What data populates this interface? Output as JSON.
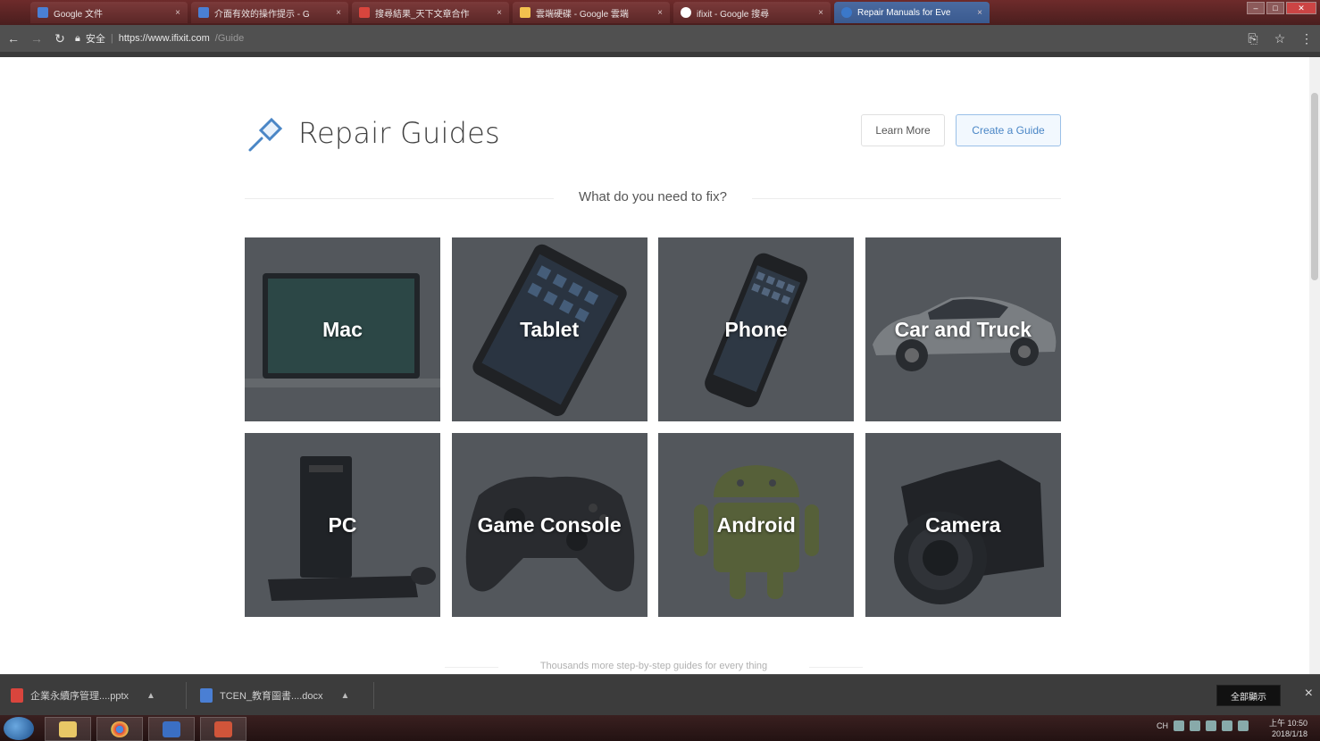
{
  "browser": {
    "tabs": [
      {
        "title": "Google 文件",
        "favicon_color": "#4a7fd4"
      },
      {
        "title": "介面有效的操作提示 - G",
        "favicon_color": "#4a7fd4"
      },
      {
        "title": "搜尋結果_天下文章合作",
        "favicon_color": "#d9453d"
      },
      {
        "title": "雲端硬碟 - Google 雲端",
        "favicon_color": "#f2c14e"
      },
      {
        "title": "ifixit - Google 搜尋",
        "favicon_color": "#ffffff"
      },
      {
        "title": "Repair Manuals for Eve",
        "favicon_color": "#3b78c9"
      }
    ],
    "tab_close": "×",
    "address": {
      "secure_label": "安全",
      "url_host": "https://www.ifixit.com",
      "url_path": "/Guide"
    }
  },
  "page": {
    "title": "Repair Guides",
    "learn_more": "Learn More",
    "create_guide": "Create a Guide",
    "prompt": "What do you need to fix?",
    "categories": [
      {
        "label": "Mac"
      },
      {
        "label": "Tablet"
      },
      {
        "label": "Phone"
      },
      {
        "label": "Car and Truck"
      },
      {
        "label": "PC"
      },
      {
        "label": "Game Console"
      },
      {
        "label": "Android"
      },
      {
        "label": "Camera"
      }
    ],
    "more_text": "Thousands more step-by-step guides for every thing"
  },
  "downloads": {
    "items": [
      {
        "name": "企業永續序管理....pptx",
        "color": "#d9453d"
      },
      {
        "name": "TCEN_教育圖書....docx",
        "color": "#4a7fd4"
      }
    ],
    "show_all": "全部顯示",
    "close": "×"
  },
  "taskbar": {
    "tray_lang": "CH",
    "time": "上午 10:50",
    "date": "2018/1/18"
  },
  "colors": {
    "brand_blue": "#4a86c6",
    "tile_bg": "#5c6166",
    "android_green": "#6f7d3e"
  }
}
